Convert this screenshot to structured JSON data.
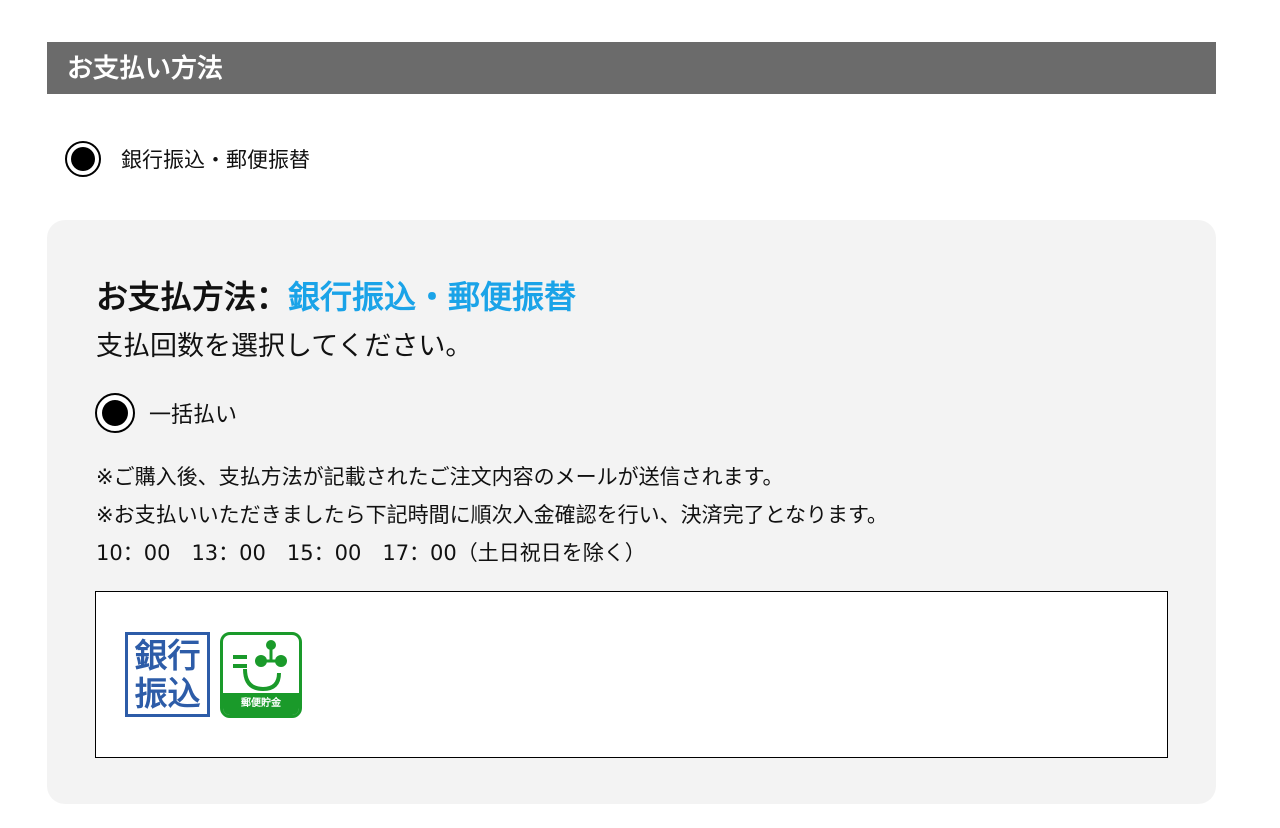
{
  "section": {
    "title": "お支払い方法"
  },
  "payment_method": {
    "label": "銀行振込・郵便振替",
    "selected": true
  },
  "panel": {
    "title_prefix": "お支払方法：",
    "title_method": "銀行振込・郵便振替",
    "subtitle": "支払回数を選択してください。",
    "installment_option": {
      "label": "一括払い",
      "selected": true
    },
    "notes": [
      "※ご購入後、支払方法が記載されたご注文内容のメールが送信されます。",
      "※お支払いいただきましたら下記時間に順次入金確認を行い、決済完了となります。",
      "10：00　13：00　15：00　17：00（土日祝日を除く）"
    ],
    "logos": {
      "bank_text_line1": "銀行",
      "bank_text_line2": "振込",
      "post_caption": "郵便貯金"
    }
  },
  "colors": {
    "header_bg": "#6b6b6b",
    "accent": "#1aa3e8",
    "panel_bg": "#f3f3f3",
    "bank_blue": "#2d5ca8",
    "post_green": "#1a9a2a"
  },
  "icons": [
    "radio-selected-icon",
    "bank-transfer-logo",
    "japan-post-logo"
  ]
}
